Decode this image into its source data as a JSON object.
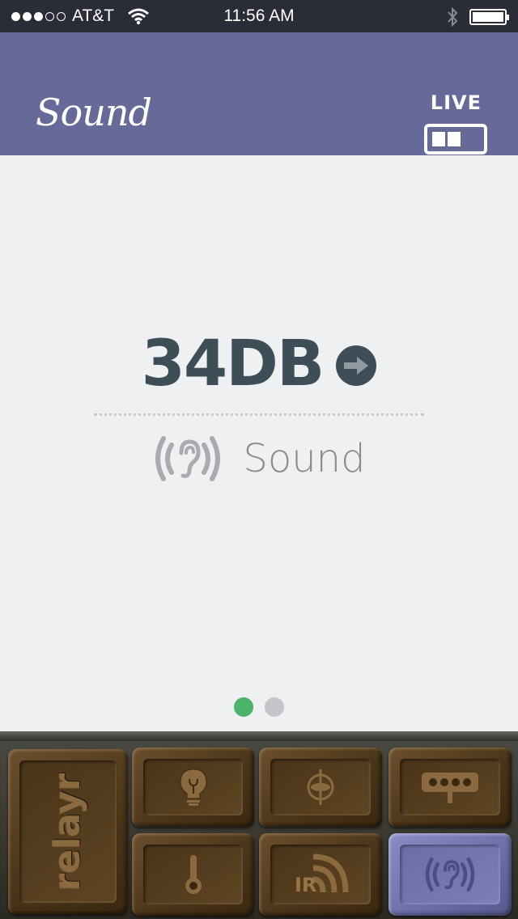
{
  "status_bar": {
    "carrier": "AT&T",
    "time": "11:56 AM",
    "signal_dots": 3,
    "signal_total": 5
  },
  "header": {
    "title": "Sound",
    "live_label": "LIVE",
    "background": "#656a98"
  },
  "reading": {
    "value": "34DB",
    "sensor_name": "Sound",
    "value_color": "#3d4e57"
  },
  "pager": {
    "pages": 2,
    "active_index": 0,
    "active_color": "#4bb46a"
  },
  "tray": {
    "brand": "relayr",
    "tiles": [
      {
        "icon": "light-bulb-icon"
      },
      {
        "icon": "gyroscope-icon"
      },
      {
        "icon": "color-sensor-icon"
      },
      {
        "icon": "thermometer-icon"
      },
      {
        "icon": "ir-sensor-icon",
        "label": "IR"
      },
      {
        "icon": "sound-ear-icon",
        "active": true
      }
    ]
  }
}
